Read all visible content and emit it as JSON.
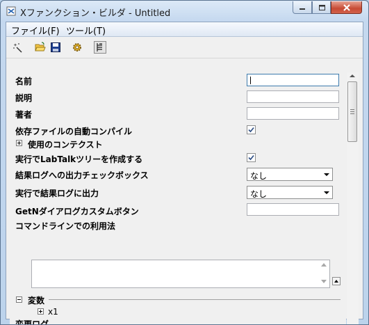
{
  "window": {
    "title": "Xファンクション・ビルダ - Untitled"
  },
  "menu": {
    "file": "ファイル(F)",
    "tools": "ツール(T)"
  },
  "toolbar": {
    "icons": [
      "magic-wand-icon",
      "open-folder-icon",
      "save-disk-icon",
      "compile-gear-icon",
      "tree-view-icon"
    ]
  },
  "fields": {
    "name": {
      "label": "名前",
      "value": ""
    },
    "description": {
      "label": "説明",
      "value": ""
    },
    "author": {
      "label": "著者",
      "value": ""
    },
    "auto_compile": {
      "label": "依存ファイルの自動コンパイル",
      "checked": true
    },
    "context": {
      "label": "使用のコンテクスト"
    },
    "labtalk_tree": {
      "label": "実行でLabTalkツリーを作成する",
      "checked": true
    },
    "result_log_checkbox": {
      "label": "結果ログへの出力チェックボックス",
      "value": "なし"
    },
    "result_log_output": {
      "label": "実行で結果ログに出力",
      "value": "なし"
    },
    "getn_button": {
      "label": "GetNダイアログカスタムボタン",
      "value": ""
    },
    "command_line": {
      "label": "コマンドラインでの利用法",
      "value": ""
    }
  },
  "variables": {
    "label": "変数",
    "child": "x1"
  },
  "changelog": {
    "label": "変更ログ"
  }
}
